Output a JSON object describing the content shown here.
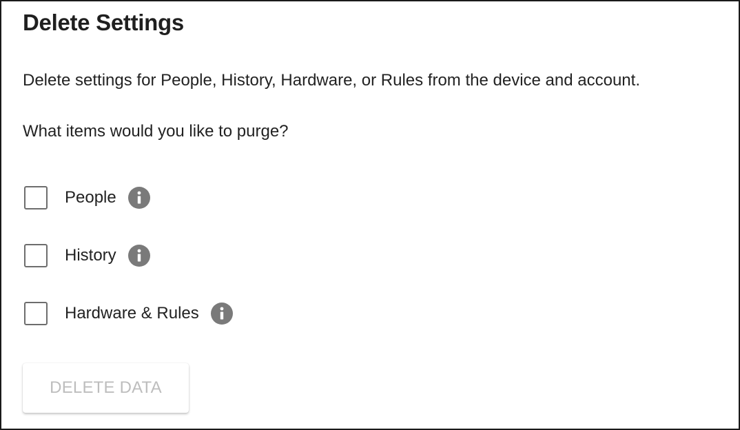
{
  "title": "Delete Settings",
  "description": "Delete settings for People, History, Hardware, or Rules from the device and account.",
  "question": "What items would you like to purge?",
  "options": [
    {
      "label": "People",
      "checked": false,
      "icon": "info-icon"
    },
    {
      "label": "History",
      "checked": false,
      "icon": "info-icon"
    },
    {
      "label": "Hardware & Rules",
      "checked": false,
      "icon": "info-icon"
    }
  ],
  "delete_button": {
    "label": "DELETE DATA",
    "disabled": true
  },
  "colors": {
    "text": "#222222",
    "checkbox_border": "#6d6d6d",
    "info_icon": "#7a7a7a",
    "disabled_text": "#bdbdbd"
  }
}
